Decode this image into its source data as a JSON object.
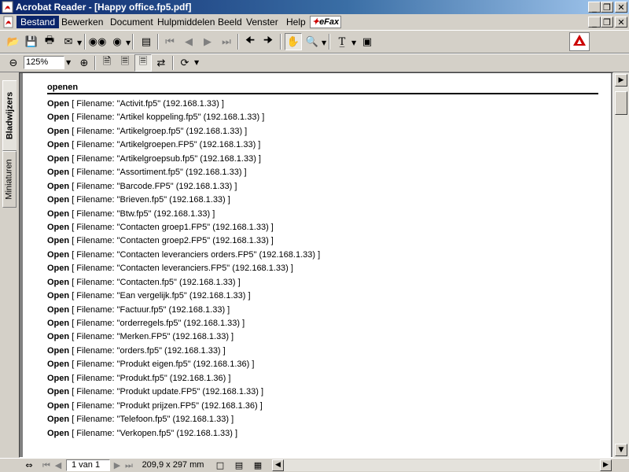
{
  "window": {
    "title": "Acrobat Reader - [Happy office.fp5.pdf]"
  },
  "menu": {
    "items": [
      "Bestand",
      "Bewerken",
      "Document",
      "Hulpmiddelen",
      "Beeld",
      "Venster",
      "Help"
    ],
    "efax_label": "eFax"
  },
  "toolbar": {
    "zoom_value": "125%",
    "adobe_logo_text": "Adobe"
  },
  "nav_tabs": {
    "bookmarks": "Bladwijzers",
    "thumbnails": "Miniaturen"
  },
  "document": {
    "section_header": "openen",
    "keyword": "Open",
    "entries": [
      "[ Filename: \"Activit.fp5\" (192.168.1.33) ]",
      "[ Filename: \"Artikel koppeling.fp5\" (192.168.1.33) ]",
      "[ Filename: \"Artikelgroep.fp5\" (192.168.1.33) ]",
      "[ Filename: \"Artikelgroepen.FP5\" (192.168.1.33) ]",
      "[ Filename: \"Artikelgroepsub.fp5\" (192.168.1.33) ]",
      "[ Filename: \"Assortiment.fp5\" (192.168.1.33) ]",
      "[ Filename: \"Barcode.FP5\" (192.168.1.33) ]",
      "[ Filename: \"Brieven.fp5\" (192.168.1.33) ]",
      "[ Filename: \"Btw.fp5\" (192.168.1.33) ]",
      "[ Filename: \"Contacten groep1.FP5\" (192.168.1.33) ]",
      "[ Filename: \"Contacten groep2.FP5\" (192.168.1.33) ]",
      "[ Filename: \"Contacten leveranciers orders.FP5\" (192.168.1.33) ]",
      "[ Filename: \"Contacten leveranciers.FP5\" (192.168.1.33) ]",
      "[ Filename: \"Contacten.fp5\" (192.168.1.33) ]",
      "[ Filename: \"Ean vergelijk.fp5\" (192.168.1.33) ]",
      "[ Filename: \"Factuur.fp5\" (192.168.1.33) ]",
      "[ Filename: \"orderregels.fp5\" (192.168.1.33) ]",
      "[ Filename: \"Merken.FP5\" (192.168.1.33) ]",
      "[ Filename: \"orders.fp5\" (192.168.1.33) ]",
      "[ Filename: \"Produkt eigen.fp5\" (192.168.1.36) ]",
      "[ Filename: \"Produkt.fp5\" (192.168.1.36) ]",
      "[ Filename: \"Produkt update.FP5\" (192.168.1.33) ]",
      "[ Filename: \"Produkt prijzen.FP5\" (192.168.1.36) ]",
      "[ Filename: \"Telefoon.fp5\" (192.168.1.33) ]",
      "[ Filename: \"Verkopen.fp5\" (192.168.1.33) ]"
    ]
  },
  "status": {
    "page_indicator": "1 van 1",
    "page_size": "209,9 x 297 mm"
  },
  "colors": {
    "title_gradient_start": "#0a246a",
    "title_gradient_end": "#a6caf0",
    "chrome": "#d4d0c8",
    "menu_highlight": "#0a246a",
    "adobe_red": "#cc0000"
  }
}
